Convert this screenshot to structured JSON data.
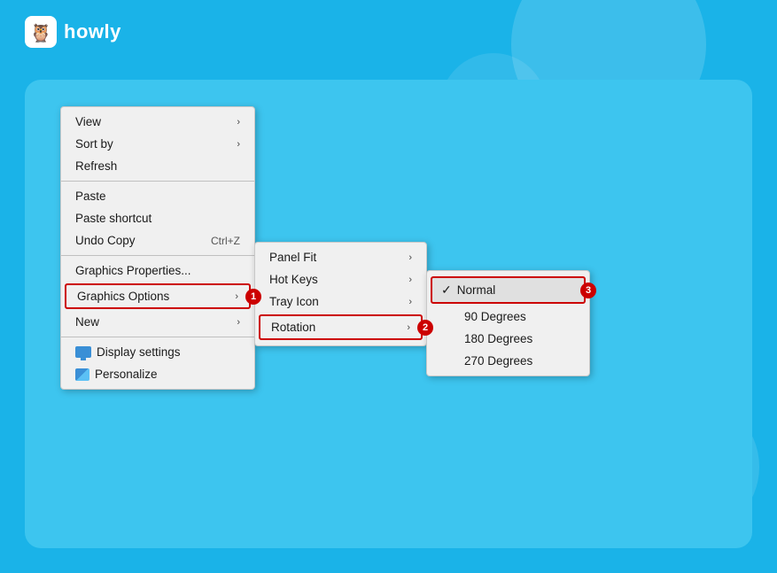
{
  "app": {
    "name": "howly"
  },
  "main_menu": {
    "items": [
      {
        "label": "View",
        "has_arrow": true,
        "shortcut": ""
      },
      {
        "label": "Sort by",
        "has_arrow": true,
        "shortcut": ""
      },
      {
        "label": "Refresh",
        "has_arrow": false,
        "shortcut": ""
      },
      {
        "label": "Paste",
        "has_arrow": false,
        "shortcut": ""
      },
      {
        "label": "Paste shortcut",
        "has_arrow": false,
        "shortcut": ""
      },
      {
        "label": "Undo Copy",
        "has_arrow": false,
        "shortcut": "Ctrl+Z"
      },
      {
        "label": "Graphics Properties...",
        "has_arrow": false,
        "shortcut": ""
      },
      {
        "label": "Graphics Options",
        "has_arrow": true,
        "shortcut": "",
        "highlighted": true,
        "badge": "1"
      },
      {
        "label": "New",
        "has_arrow": true,
        "shortcut": ""
      },
      {
        "label": "Display settings",
        "has_arrow": false,
        "shortcut": "",
        "has_icon": "display"
      },
      {
        "label": "Personalize",
        "has_arrow": false,
        "shortcut": "",
        "has_icon": "personalize"
      }
    ]
  },
  "submenu_graphics": {
    "items": [
      {
        "label": "Panel Fit",
        "has_arrow": true
      },
      {
        "label": "Hot Keys",
        "has_arrow": true
      },
      {
        "label": "Tray Icon",
        "has_arrow": true
      },
      {
        "label": "Rotation",
        "has_arrow": true,
        "highlighted": true,
        "badge": "2"
      }
    ]
  },
  "submenu_rotation": {
    "items": [
      {
        "label": "Normal",
        "checked": true,
        "highlighted": true,
        "badge": "3"
      },
      {
        "label": "90 Degrees",
        "checked": false
      },
      {
        "label": "180 Degrees",
        "checked": false
      },
      {
        "label": "270 Degrees",
        "checked": false
      }
    ]
  },
  "badges": {
    "graphics_options": "1",
    "rotation": "2",
    "normal": "3"
  }
}
